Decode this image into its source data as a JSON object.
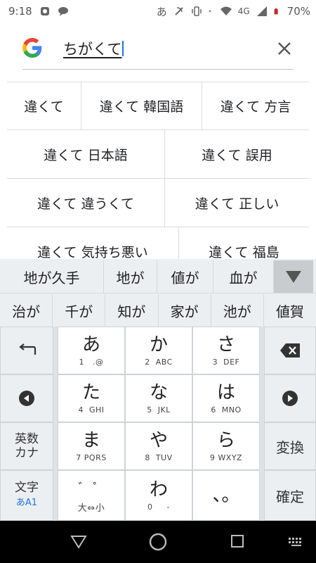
{
  "status_bar": {
    "time": "9:18",
    "ime_indicator": "あ",
    "network": "4G",
    "battery": "70%"
  },
  "search": {
    "query": "ちがくて"
  },
  "suggestions": [
    [
      "違くて",
      "違くて 韓国語",
      "違くて 方言"
    ],
    [
      "違くて 日本語",
      "違くて 誤用"
    ],
    [
      "違くて 違うくて",
      "違くて 正しい"
    ],
    [
      "違くて 気持ち悪い",
      "違くて 福島"
    ]
  ],
  "candidates": {
    "row1": [
      "地が久手",
      "地が",
      "値が",
      "血が"
    ],
    "row2": [
      "治が",
      "千が",
      "知が",
      "家が",
      "池が",
      "値賀"
    ]
  },
  "keyboard": {
    "keys": [
      {
        "kana": "あ",
        "sub": "1   .@"
      },
      {
        "kana": "か",
        "sub": "2  ABC"
      },
      {
        "kana": "さ",
        "sub": "3  DEF"
      },
      {
        "kana": "た",
        "sub": "4  GHI"
      },
      {
        "kana": "な",
        "sub": "5  JKL"
      },
      {
        "kana": "は",
        "sub": "6  MNO"
      },
      {
        "kana": "ま",
        "sub": "7 PQRS"
      },
      {
        "kana": "や",
        "sub": "8  TUV"
      },
      {
        "kana": "ら",
        "sub": "9 WXYZ"
      },
      {
        "kana": "゛ ゜",
        "sub": "大⇔小"
      },
      {
        "kana": "わ",
        "sub": "0     -"
      },
      {
        "kana": "、。",
        "sub": ""
      }
    ],
    "eisu_kana_line1": "英数",
    "eisu_kana_line2": "カナ",
    "moji_line1": "文字",
    "moji_line2": "あA1",
    "henkan": "変換",
    "kakutei": "確定"
  },
  "colors": {
    "accent": "#1a73e8",
    "candidate_bg": "#eceff1",
    "keyboard_bg": "#dfe2e5"
  }
}
